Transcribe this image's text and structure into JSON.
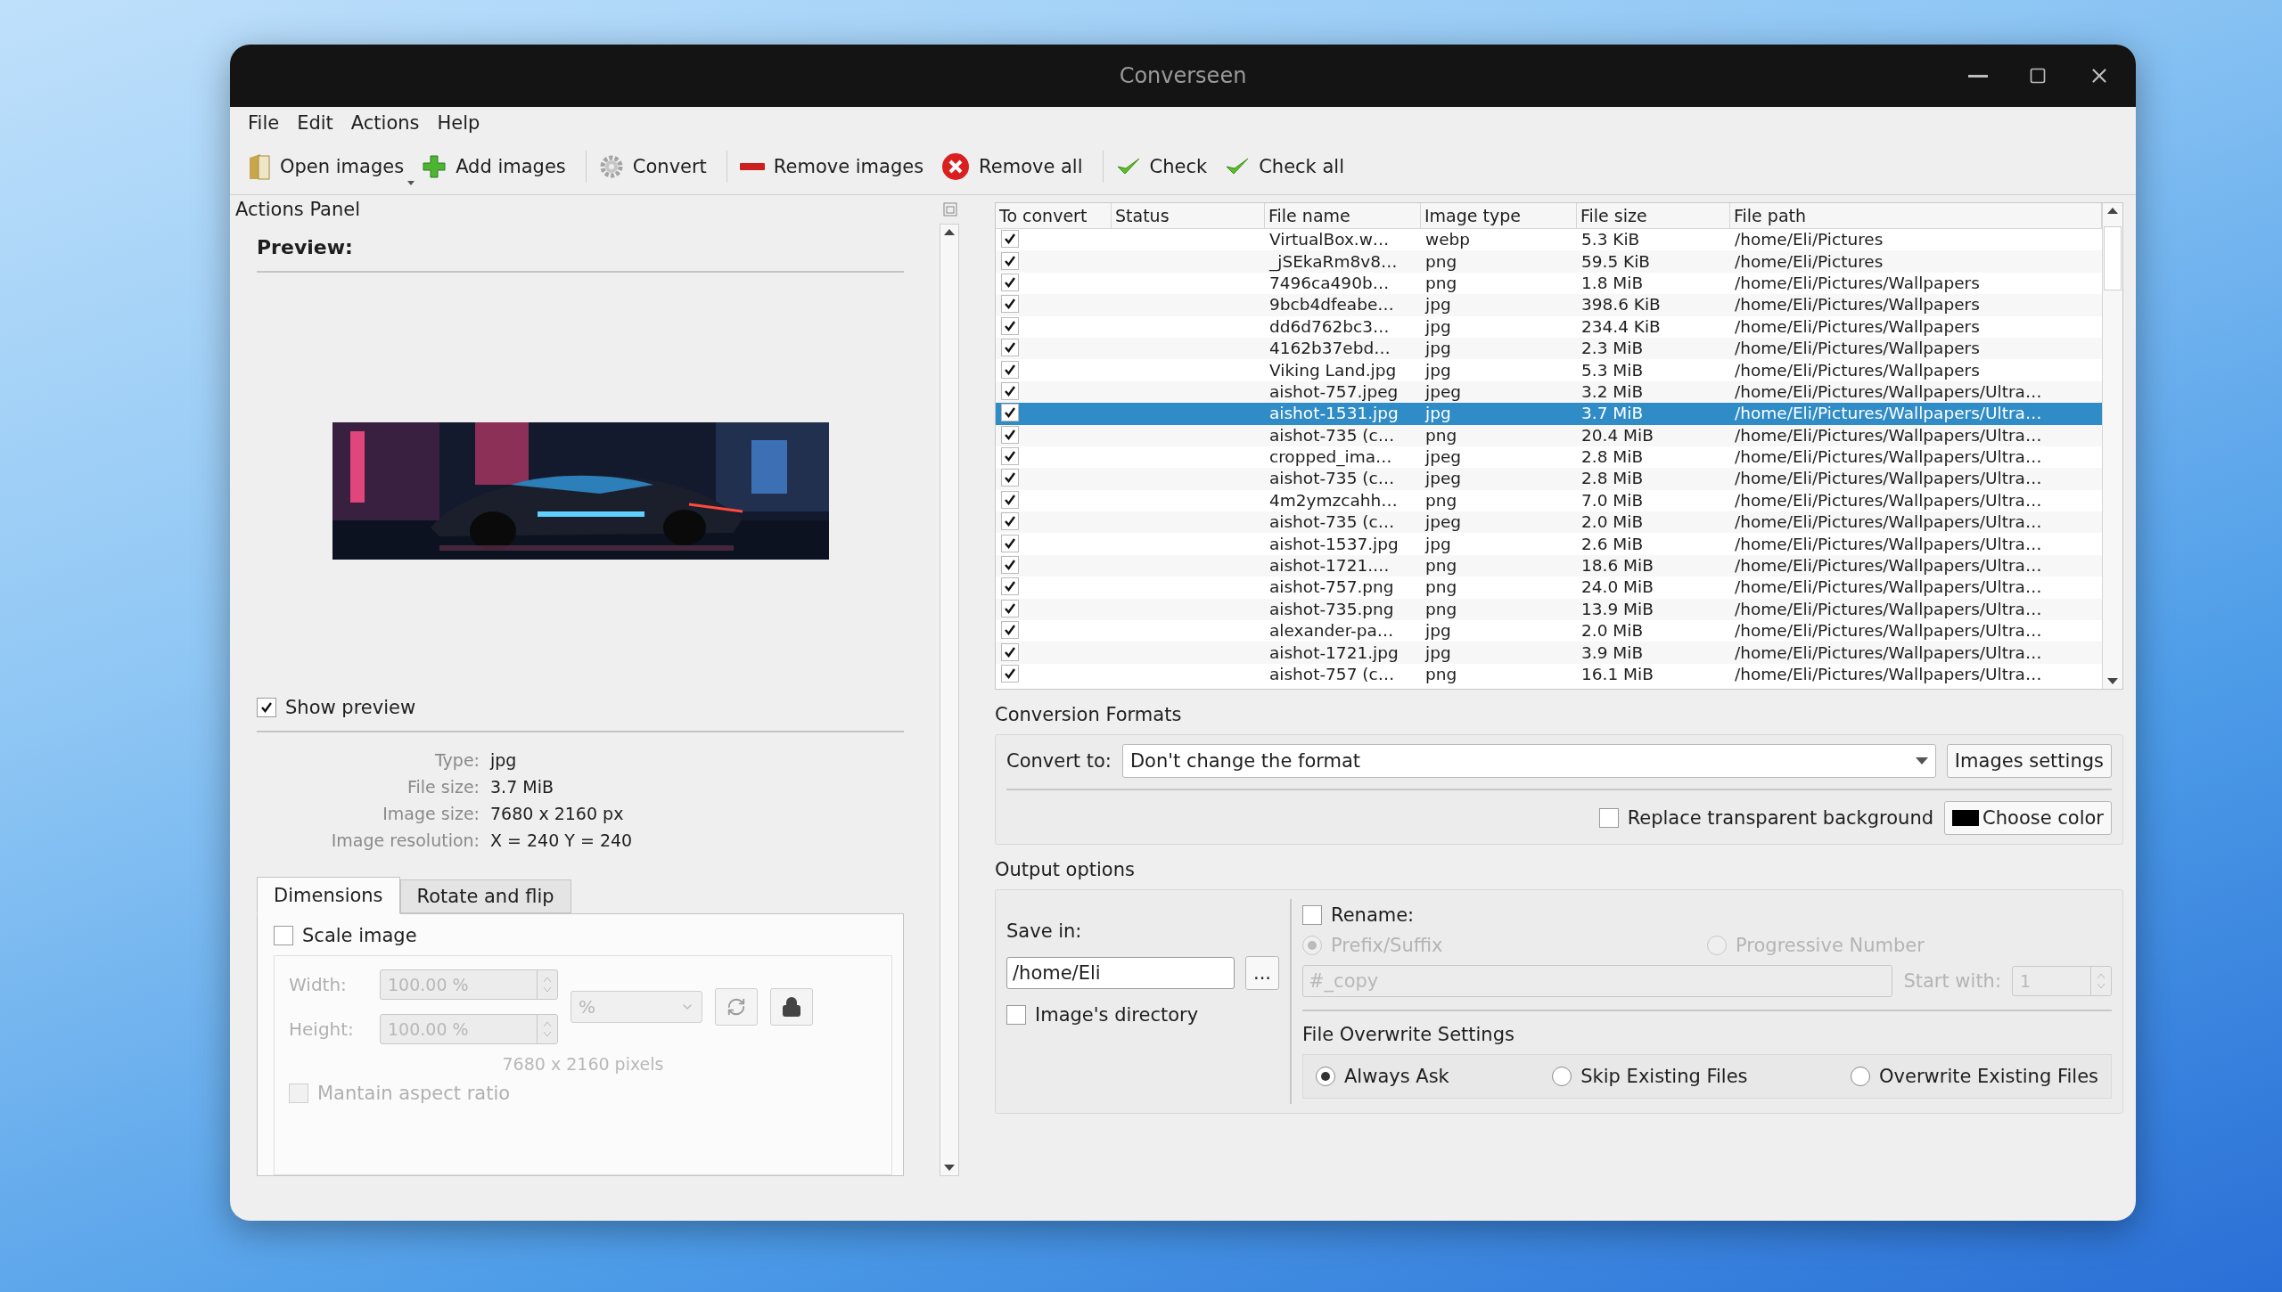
{
  "window": {
    "title": "Converseen"
  },
  "menu": [
    {
      "label": "File"
    },
    {
      "label": "Edit"
    },
    {
      "label": "Actions"
    },
    {
      "label": "Help"
    }
  ],
  "toolbar": [
    {
      "kind": "open",
      "label": "Open images",
      "has_menu": true
    },
    {
      "kind": "add",
      "label": "Add images",
      "separator_after": true
    },
    {
      "kind": "convert",
      "label": "Convert",
      "separator_after": true
    },
    {
      "kind": "remove",
      "label": "Remove images"
    },
    {
      "kind": "remove_all",
      "label": "Remove all",
      "separator_after": true
    },
    {
      "kind": "check",
      "label": "Check"
    },
    {
      "kind": "check",
      "label": "Check all"
    }
  ],
  "actions_panel": {
    "title": "Actions Panel",
    "preview_heading": "Preview:",
    "show_preview": {
      "label": "Show preview",
      "checked": true
    },
    "info": [
      {
        "label": "Type:",
        "value": "jpg"
      },
      {
        "label": "File size:",
        "value": "3.7 MiB"
      },
      {
        "label": "Image size:",
        "value": "7680 x 2160 px"
      },
      {
        "label": "Image resolution:",
        "value": "X = 240 Y = 240"
      }
    ],
    "tabs": [
      {
        "label": "Dimensions",
        "selected": true
      },
      {
        "label": "Rotate and flip",
        "selected": false
      }
    ],
    "scale_image": {
      "label": "Scale image",
      "checked": false
    },
    "width": {
      "label": "Width:",
      "value": "100.00 %"
    },
    "height": {
      "label": "Height:",
      "value": "100.00 %"
    },
    "unit": "%",
    "pixels_note": "7680 x 2160 pixels",
    "maintain_aspect": {
      "label": "Mantain aspect ratio",
      "checked": false
    }
  },
  "table": {
    "columns": [
      "To convert",
      "Status",
      "File name",
      "Image type",
      "File size",
      "File path"
    ],
    "rows": [
      {
        "checked": true,
        "selected": false,
        "file_name": "VirtualBox.w…",
        "image_type": "webp",
        "file_size": "5.3 KiB",
        "file_path": "/home/Eli/Pictures"
      },
      {
        "checked": true,
        "selected": false,
        "file_name": "_jSEkaRm8v8…",
        "image_type": "png",
        "file_size": "59.5 KiB",
        "file_path": "/home/Eli/Pictures"
      },
      {
        "checked": true,
        "selected": false,
        "file_name": "7496ca490b…",
        "image_type": "png",
        "file_size": "1.8 MiB",
        "file_path": "/home/Eli/Pictures/Wallpapers"
      },
      {
        "checked": true,
        "selected": false,
        "file_name": "9bcb4dfeabe…",
        "image_type": "jpg",
        "file_size": "398.6 KiB",
        "file_path": "/home/Eli/Pictures/Wallpapers"
      },
      {
        "checked": true,
        "selected": false,
        "file_name": "dd6d762bc3…",
        "image_type": "jpg",
        "file_size": "234.4 KiB",
        "file_path": "/home/Eli/Pictures/Wallpapers"
      },
      {
        "checked": true,
        "selected": false,
        "file_name": "4162b37ebd…",
        "image_type": "jpg",
        "file_size": "2.3 MiB",
        "file_path": "/home/Eli/Pictures/Wallpapers"
      },
      {
        "checked": true,
        "selected": false,
        "file_name": "Viking Land.jpg",
        "image_type": "jpg",
        "file_size": "5.3 MiB",
        "file_path": "/home/Eli/Pictures/Wallpapers"
      },
      {
        "checked": true,
        "selected": false,
        "file_name": "aishot-757.jpeg",
        "image_type": "jpeg",
        "file_size": "3.2 MiB",
        "file_path": "/home/Eli/Pictures/Wallpapers/Ultra…"
      },
      {
        "checked": true,
        "selected": true,
        "file_name": "aishot-1531.jpg",
        "image_type": "jpg",
        "file_size": "3.7 MiB",
        "file_path": "/home/Eli/Pictures/Wallpapers/Ultra…"
      },
      {
        "checked": true,
        "selected": false,
        "file_name": "aishot-735 (c…",
        "image_type": "png",
        "file_size": "20.4 MiB",
        "file_path": "/home/Eli/Pictures/Wallpapers/Ultra…"
      },
      {
        "checked": true,
        "selected": false,
        "file_name": "cropped_ima…",
        "image_type": "jpeg",
        "file_size": "2.8 MiB",
        "file_path": "/home/Eli/Pictures/Wallpapers/Ultra…"
      },
      {
        "checked": true,
        "selected": false,
        "file_name": "aishot-735 (c…",
        "image_type": "jpeg",
        "file_size": "2.8 MiB",
        "file_path": "/home/Eli/Pictures/Wallpapers/Ultra…"
      },
      {
        "checked": true,
        "selected": false,
        "file_name": "4m2ymzcahh…",
        "image_type": "png",
        "file_size": "7.0 MiB",
        "file_path": "/home/Eli/Pictures/Wallpapers/Ultra…"
      },
      {
        "checked": true,
        "selected": false,
        "file_name": "aishot-735 (c…",
        "image_type": "jpeg",
        "file_size": "2.0 MiB",
        "file_path": "/home/Eli/Pictures/Wallpapers/Ultra…"
      },
      {
        "checked": true,
        "selected": false,
        "file_name": "aishot-1537.jpg",
        "image_type": "jpg",
        "file_size": "2.6 MiB",
        "file_path": "/home/Eli/Pictures/Wallpapers/Ultra…"
      },
      {
        "checked": true,
        "selected": false,
        "file_name": "aishot-1721.…",
        "image_type": "png",
        "file_size": "18.6 MiB",
        "file_path": "/home/Eli/Pictures/Wallpapers/Ultra…"
      },
      {
        "checked": true,
        "selected": false,
        "file_name": "aishot-757.png",
        "image_type": "png",
        "file_size": "24.0 MiB",
        "file_path": "/home/Eli/Pictures/Wallpapers/Ultra…"
      },
      {
        "checked": true,
        "selected": false,
        "file_name": "aishot-735.png",
        "image_type": "png",
        "file_size": "13.9 MiB",
        "file_path": "/home/Eli/Pictures/Wallpapers/Ultra…"
      },
      {
        "checked": true,
        "selected": false,
        "file_name": "alexander-pa…",
        "image_type": "jpg",
        "file_size": "2.0 MiB",
        "file_path": "/home/Eli/Pictures/Wallpapers/Ultra…"
      },
      {
        "checked": true,
        "selected": false,
        "file_name": "aishot-1721.jpg",
        "image_type": "jpg",
        "file_size": "3.9 MiB",
        "file_path": "/home/Eli/Pictures/Wallpapers/Ultra…"
      },
      {
        "checked": true,
        "selected": false,
        "file_name": "aishot-757 (c…",
        "image_type": "png",
        "file_size": "16.1 MiB",
        "file_path": "/home/Eli/Pictures/Wallpapers/Ultra…"
      }
    ]
  },
  "conversion_formats": {
    "title": "Conversion Formats",
    "convert_to_label": "Convert to:",
    "format": "Don't change the format",
    "images_settings": "Images settings",
    "replace_transparent": {
      "label": "Replace transparent background",
      "checked": false
    },
    "choose_color": {
      "label": "Choose color",
      "color": "#000000"
    }
  },
  "output_options": {
    "title": "Output options",
    "save_in_label": "Save in:",
    "save_path": "/home/Eli",
    "browse": "...",
    "images_directory": {
      "label": "Image's directory",
      "checked": false
    },
    "rename": {
      "label": "Rename:",
      "checked": false
    },
    "rename_modes": [
      {
        "label": "Prefix/Suffix",
        "selected": true
      },
      {
        "label": "Progressive Number",
        "selected": false
      }
    ],
    "pattern": "#_copy",
    "start_with_label": "Start with:",
    "start_with": "1",
    "overwrite_title": "File Overwrite Settings",
    "overwrite_modes": [
      {
        "label": "Always Ask",
        "selected": true
      },
      {
        "label": "Skip Existing Files",
        "selected": false
      },
      {
        "label": "Overwrite Existing Files",
        "selected": false
      }
    ]
  }
}
